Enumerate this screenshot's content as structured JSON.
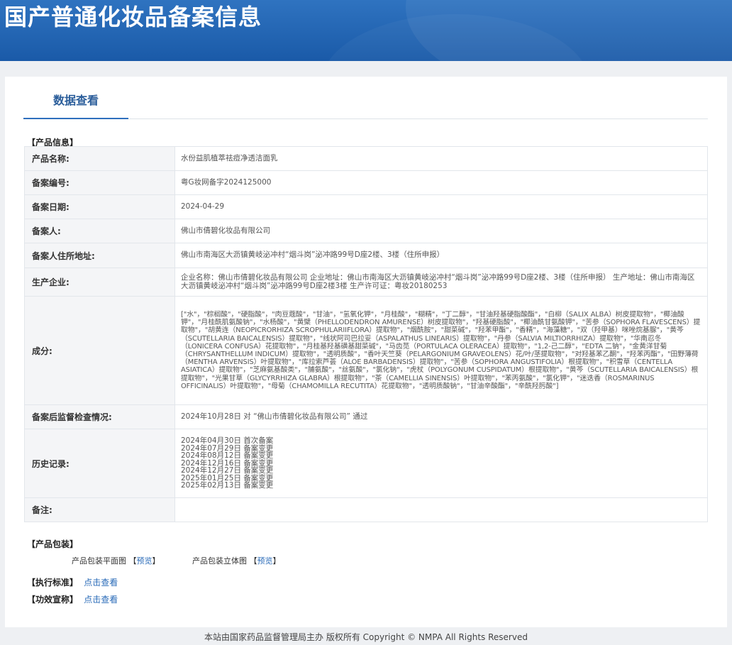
{
  "header": {
    "title": "国产普通化妆品备案信息"
  },
  "tab": {
    "label": "数据查看"
  },
  "sections": {
    "product_info": "【产品信息】",
    "packaging": "【产品包装】",
    "standard": "【执行标准】",
    "efficacy": "【功效宣称】"
  },
  "rows": {
    "name": {
      "label": "产品名称:",
      "value": "水份益肌植萃祛痘净透洁面乳"
    },
    "record_no": {
      "label": "备案编号:",
      "value": "粤G妆网备字2024125000"
    },
    "record_date": {
      "label": "备案日期:",
      "value": "2024-04-29"
    },
    "registrant": {
      "label": "备案人:",
      "value": "佛山市倩碧化妆品有限公司"
    },
    "address": {
      "label": "备案人住所地址:",
      "value": "佛山市南海区大沥镇黄岐泌冲村“烟斗岗”泌冲路99号D座2楼、3楼（住所申报）"
    },
    "producer": {
      "label": "生产企业:",
      "value": "企业名称：佛山市倩碧化妆品有限公司 企业地址：佛山市南海区大沥镇黄岐泌冲村“烟斗岗”泌冲路99号D座2楼、3楼（住所申报） 生产地址：佛山市南海区大沥镇黄岐泌冲村“烟斗岗”泌冲路99号D座2楼3楼 生产许可证：粤妆20180253"
    },
    "ingredients": {
      "label": "成分:",
      "value": "[\"水\"，\"棕榈酸\"，\"硬脂酸\"，\"肉豆蔻酸\"，\"甘油\"，\"氢氧化钾\"，\"月桂酸\"，\"糊精\"，\"丁二醇\"，\"甘油羟基硬脂酸酯\"，\"白柳（SALIX ALBA）树皮提取物\"，\"椰油酸钾\"，\"月桂酰肌氨酸钠\"，\"水杨酸\"，\"黄檗（PHELLODENDRON AMURENSE）树皮提取物\"，\"羟基硬脂酸\"，\"椰油酰甘氨酸钾\"，\"苦参（SOPHORA FLAVESCENS）提取物\"，\"胡黄连（NEOPICRORHIZA SCROPHULARIIFLORA）提取物\"，\"烟酰胺\"，\"甜菜碱\"，\"羟苯甲酯\"，\"香精\"，\"海藻糖\"，\"双（羟甲基）咪唑烷基脲\"，\"黄芩（SCUTELLARIA BAICALENSIS）提取物\"，\"线状阿司巴拉妥（ASPALATHUS LINEARIS）提取物\"，\"丹参（SALVIA MILTIORRHIZA）提取物\"，\"华南忍冬（LONICERA CONFUSA）花提取物\"，\"月桂基羟基磺基甜菜碱\"，\"马齿苋（PORTULACA OLERACEA）提取物\"，\"1,2-己二醇\"，\"EDTA 二钠\"，\"金黄洋甘菊（CHRYSANTHELLUM INDICUM）提取物\"，\"透明质酸\"，\"香叶天竺葵（PELARGONIUM GRAVEOLENS）花/叶/茎提取物\"，\"对羟基苯乙酮\"，\"羟苯丙酯\"，\"田野薄荷（MENTHA ARVENSIS）叶提取物\"，\"库拉索芦荟（ALOE BARBADENSIS）提取物\"，\"苦参（SOPHORA ANGUSTIFOLIA）根提取物\"，\"积雪草（CENTELLA ASIATICA）提取物\"，\"芝麻氨基酸类\"，\"脯氨酸\"，\"丝氨酸\"，\"氯化钠\"，\"虎杖（POLYGONUM CUSPIDATUM）根提取物\"，\"黄芩（SCUTELLARIA BAICALENSIS）根提取物\"，\"光果甘草（GLYCYRRHIZA GLABRA）根提取物\"，\"茶（CAMELLIA SINENSIS）叶提取物\"，\"苯丙氨酸\"，\"氯化钾\"，\"迷迭香（ROSMARINUS OFFICINALIS）叶提取物\"，\"母菊（CHAMOMILLA RECUTITA）花提取物\"，\"透明质酸钠\"，\"甘油辛酸酯\"，\"辛酰羟肟酸\"]"
    },
    "inspection": {
      "label": "备案后监督检查情况:",
      "value": "2024年10月28日 对 “佛山市倩碧化妆品有限公司” 通过"
    },
    "history": {
      "label": "历史记录:",
      "entries": [
        "2024年04月30日 首次备案",
        "2024年07月29日 备案变更",
        "2024年08月12日 备案变更",
        "2024年12月16日 备案变更",
        "2024年12月27日 备案变更",
        "2025年01月25日 备案变更",
        "2025年02月13日 备案变更"
      ]
    },
    "remarks": {
      "label": "备注:",
      "value": ""
    }
  },
  "packaging": {
    "flat": {
      "label": "产品包装平面图",
      "bracket_open": "【",
      "link": "预览",
      "bracket_close": "】"
    },
    "solid": {
      "label": "产品包装立体图",
      "bracket_open": "【",
      "link": "预览",
      "bracket_close": "】"
    }
  },
  "standard": {
    "link": "点击查看"
  },
  "efficacy": {
    "link": "点击查看"
  },
  "footer": {
    "text": "本站由国家药品监督管理局主办 版权所有 Copyright © NMPA All Rights Reserved"
  }
}
